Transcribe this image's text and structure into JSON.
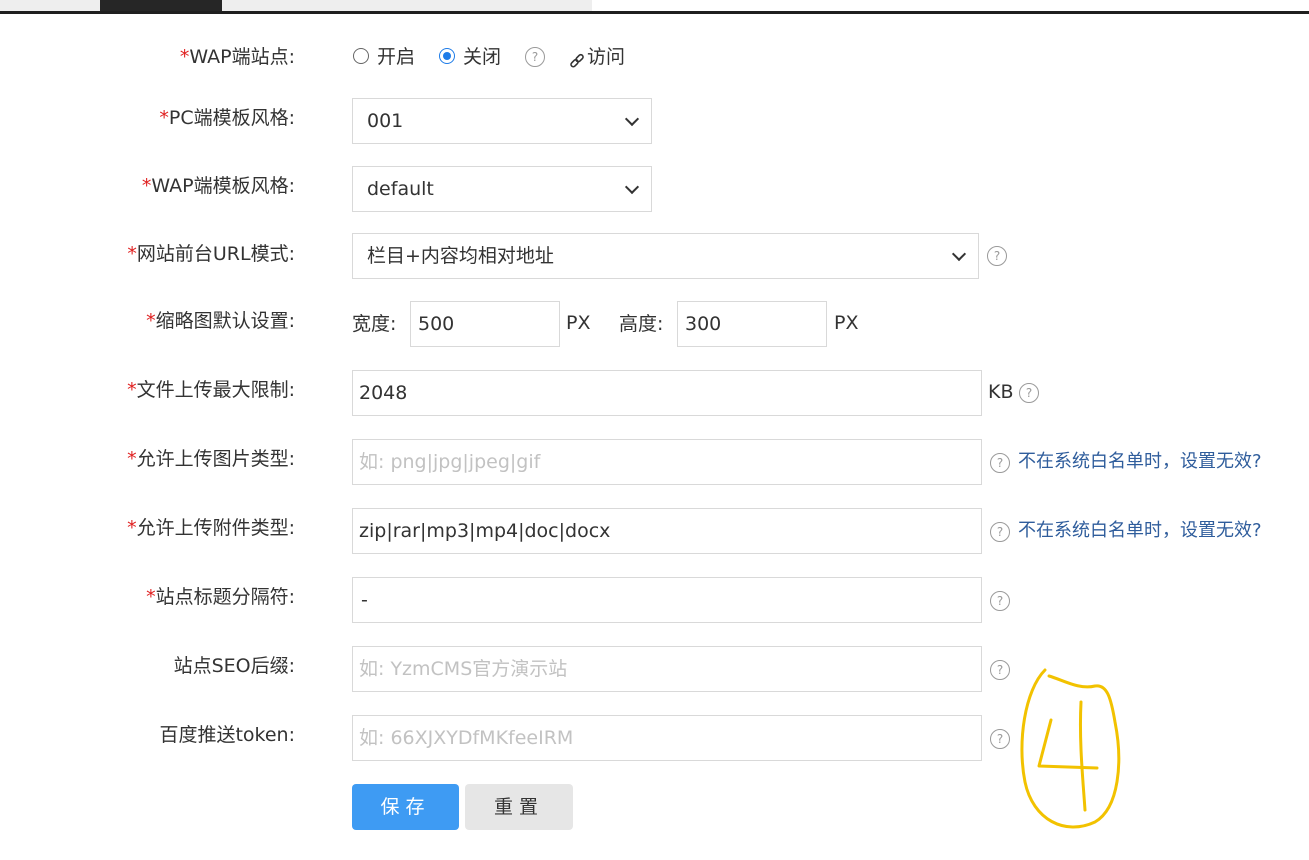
{
  "labels": {
    "wap_site": "WAP端站点:",
    "pc_template": "PC端模板风格:",
    "wap_template": "WAP端模板风格:",
    "url_mode": "网站前台URL模式:",
    "thumb": "缩略图默认设置:",
    "upload_max": "文件上传最大限制:",
    "img_types": "允许上传图片类型:",
    "attach_types": "允许上传附件类型:",
    "title_sep": "站点标题分隔符:",
    "seo_suffix": "站点SEO后缀:",
    "baidu_token": "百度推送token:"
  },
  "required_mark": "*",
  "wap_site": {
    "on": "开启",
    "off": "关闭",
    "selected": "关闭",
    "visit": "访问"
  },
  "pc_template": {
    "value": "001"
  },
  "wap_template": {
    "value": "default"
  },
  "url_mode": {
    "value": "栏目+内容均相对地址"
  },
  "thumb": {
    "width_label": "宽度:",
    "width": "500",
    "height_label": "高度:",
    "height": "300",
    "unit": "PX"
  },
  "upload_max": {
    "value": "2048",
    "unit": "KB"
  },
  "img_types": {
    "placeholder": "如: png|jpg|jpeg|gif",
    "tip": "不在系统白名单时，设置无效?"
  },
  "attach_types": {
    "value": "zip|rar|mp3|mp4|doc|docx",
    "tip": "不在系统白名单时，设置无效?"
  },
  "title_sep": {
    "value": "-"
  },
  "seo_suffix": {
    "placeholder": "如: YzmCMS官方演示站"
  },
  "baidu_token": {
    "placeholder": "如: 66XJXYDfMKfeeIRM"
  },
  "help_glyph": "?",
  "buttons": {
    "save": "保存",
    "reset": "重置"
  },
  "annotation": {
    "colour": "#f2c200"
  },
  "colors": {
    "accent": "#3e9bf3",
    "required": "#e02020",
    "link": "#2f5d9c"
  }
}
